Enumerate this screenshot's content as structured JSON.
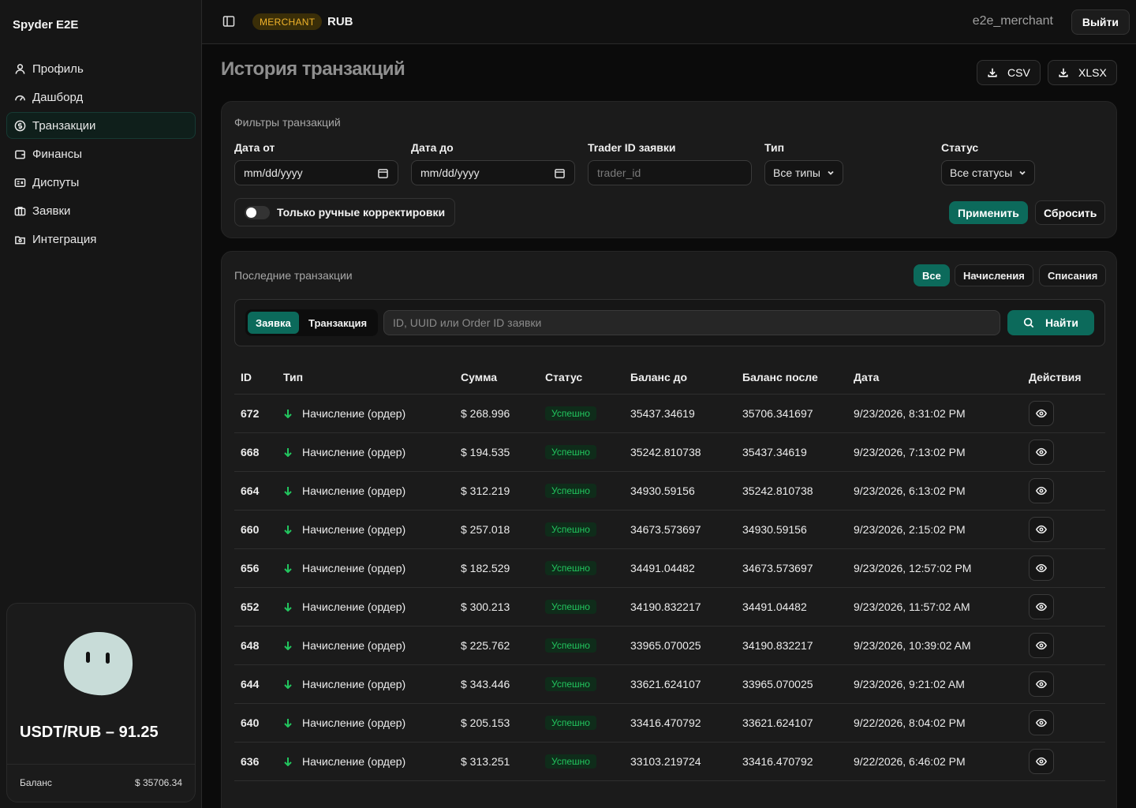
{
  "sidebar": {
    "brand": "Spyder E2E",
    "items": [
      {
        "label": "Профиль",
        "icon": "user-icon"
      },
      {
        "label": "Дашборд",
        "icon": "gauge-icon"
      },
      {
        "label": "Транзакции",
        "icon": "dollar-circle-icon",
        "active": true
      },
      {
        "label": "Финансы",
        "icon": "wallet-icon"
      },
      {
        "label": "Диспуты",
        "icon": "dispute-icon"
      },
      {
        "label": "Заявки",
        "icon": "briefcase-icon"
      },
      {
        "label": "Интеграция",
        "icon": "integration-icon"
      }
    ],
    "rate": "USDT/RUB – 91.25",
    "balance_label": "Баланс",
    "balance_value": "$ 35706.34"
  },
  "topbar": {
    "role_badge": "MERCHANT",
    "currency": "RUB",
    "username": "e2e_merchant",
    "logout_label": "Выйти"
  },
  "page": {
    "title": "История транзакций",
    "export_csv": "CSV",
    "export_xlsx": "XLSX"
  },
  "filters": {
    "title": "Фильтры транзакций",
    "date_from_label": "Дата от",
    "date_from_value": "mm/dd/yyyy",
    "date_to_label": "Дата до",
    "date_to_value": "mm/dd/yyyy",
    "trader_label": "Trader ID заявки",
    "trader_placeholder": "trader_id",
    "type_label": "Тип",
    "type_value": "Все типы",
    "status_label": "Статус",
    "status_value": "Все статусы",
    "manual_toggle_label": "Только ручные корректировки",
    "manual_toggle_on": false,
    "apply_label": "Применить",
    "reset_label": "Сбросить"
  },
  "transactions": {
    "title": "Последние транзакции",
    "chips": [
      "Все",
      "Начисления",
      "Списания"
    ],
    "active_chip": "Все",
    "seg_order": "Заявка",
    "seg_tx": "Транзакция",
    "search_placeholder": "ID, UUID или Order ID заявки",
    "find_label": "Найти",
    "columns": [
      "ID",
      "Тип",
      "Сумма",
      "Статус",
      "Баланс до",
      "Баланс после",
      "Дата",
      "Действия"
    ],
    "rows": [
      {
        "id": "672",
        "type": "Начисление (ордер)",
        "amount": "$ 268.996",
        "status": "Успешно",
        "before": "35437.34619",
        "after": "35706.341697",
        "date": "9/23/2026, 8:31:02 PM"
      },
      {
        "id": "668",
        "type": "Начисление (ордер)",
        "amount": "$ 194.535",
        "status": "Успешно",
        "before": "35242.810738",
        "after": "35437.34619",
        "date": "9/23/2026, 7:13:02 PM"
      },
      {
        "id": "664",
        "type": "Начисление (ордер)",
        "amount": "$ 312.219",
        "status": "Успешно",
        "before": "34930.59156",
        "after": "35242.810738",
        "date": "9/23/2026, 6:13:02 PM"
      },
      {
        "id": "660",
        "type": "Начисление (ордер)",
        "amount": "$ 257.018",
        "status": "Успешно",
        "before": "34673.573697",
        "after": "34930.59156",
        "date": "9/23/2026, 2:15:02 PM"
      },
      {
        "id": "656",
        "type": "Начисление (ордер)",
        "amount": "$ 182.529",
        "status": "Успешно",
        "before": "34491.04482",
        "after": "34673.573697",
        "date": "9/23/2026, 12:57:02 PM"
      },
      {
        "id": "652",
        "type": "Начисление (ордер)",
        "amount": "$ 300.213",
        "status": "Успешно",
        "before": "34190.832217",
        "after": "34491.04482",
        "date": "9/23/2026, 11:57:02 AM"
      },
      {
        "id": "648",
        "type": "Начисление (ордер)",
        "amount": "$ 225.762",
        "status": "Успешно",
        "before": "33965.070025",
        "after": "34190.832217",
        "date": "9/23/2026, 10:39:02 AM"
      },
      {
        "id": "644",
        "type": "Начисление (ордер)",
        "amount": "$ 343.446",
        "status": "Успешно",
        "before": "33621.624107",
        "after": "33965.070025",
        "date": "9/23/2026, 9:21:02 AM"
      },
      {
        "id": "640",
        "type": "Начисление (ордер)",
        "amount": "$ 205.153",
        "status": "Успешно",
        "before": "33416.470792",
        "after": "33621.624107",
        "date": "9/22/2026, 8:04:02 PM"
      },
      {
        "id": "636",
        "type": "Начисление (ордер)",
        "amount": "$ 313.251",
        "status": "Успешно",
        "before": "33103.219724",
        "after": "33416.470792",
        "date": "9/22/2026, 6:46:02 PM"
      }
    ]
  },
  "colors": {
    "accent": "#0c6a5b",
    "success": "#22c55e",
    "merchant_badge": "#f0b32a"
  }
}
